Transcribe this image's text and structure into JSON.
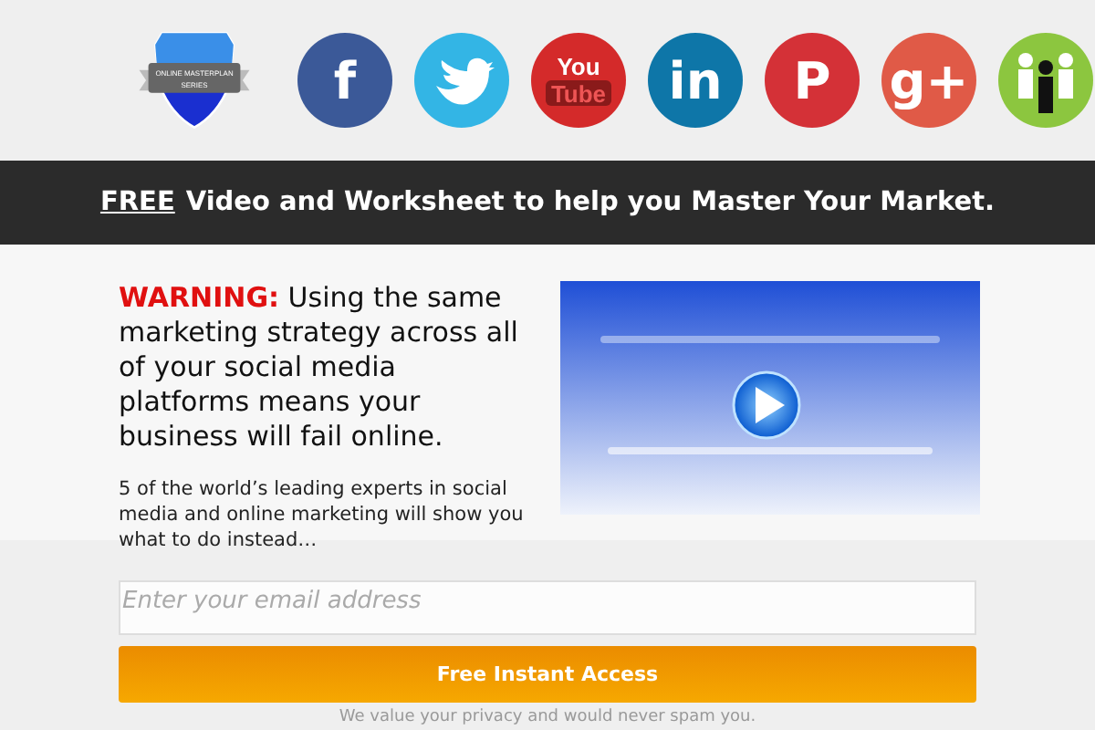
{
  "logo": {
    "ribbon_lines": [
      "ONLINE MASTERPLAN",
      "SERIES"
    ]
  },
  "social": [
    {
      "kind": "facebook",
      "glyph": "f",
      "color": "#3b5998"
    },
    {
      "kind": "twitter",
      "color": "#33b5e5"
    },
    {
      "kind": "youtube",
      "glyph": "You",
      "glyph2": "Tube",
      "color": "#d42a2a"
    },
    {
      "kind": "linkedin",
      "glyph": "in",
      "color": "#0e76a8"
    },
    {
      "kind": "pinterest",
      "glyph": "P",
      "color": "#d43137"
    },
    {
      "kind": "googleplus",
      "glyph": "g+",
      "color": "#e05a47"
    },
    {
      "kind": "group",
      "color": "#8cc63f"
    }
  ],
  "banner": {
    "lead": "FREE",
    "text": "Video and Worksheet to help you Master Your Market."
  },
  "warning": {
    "label": "WARNING:",
    "text": "Using the same marketing strategy across all of your social media platforms means your business will fail online."
  },
  "intro": "5 of the world’s leading experts in social media and online marketing will show you what to do instead…",
  "form": {
    "placeholder": "Enter your email address",
    "button": "Free Instant Access",
    "note": "We value your privacy and would never spam you."
  }
}
